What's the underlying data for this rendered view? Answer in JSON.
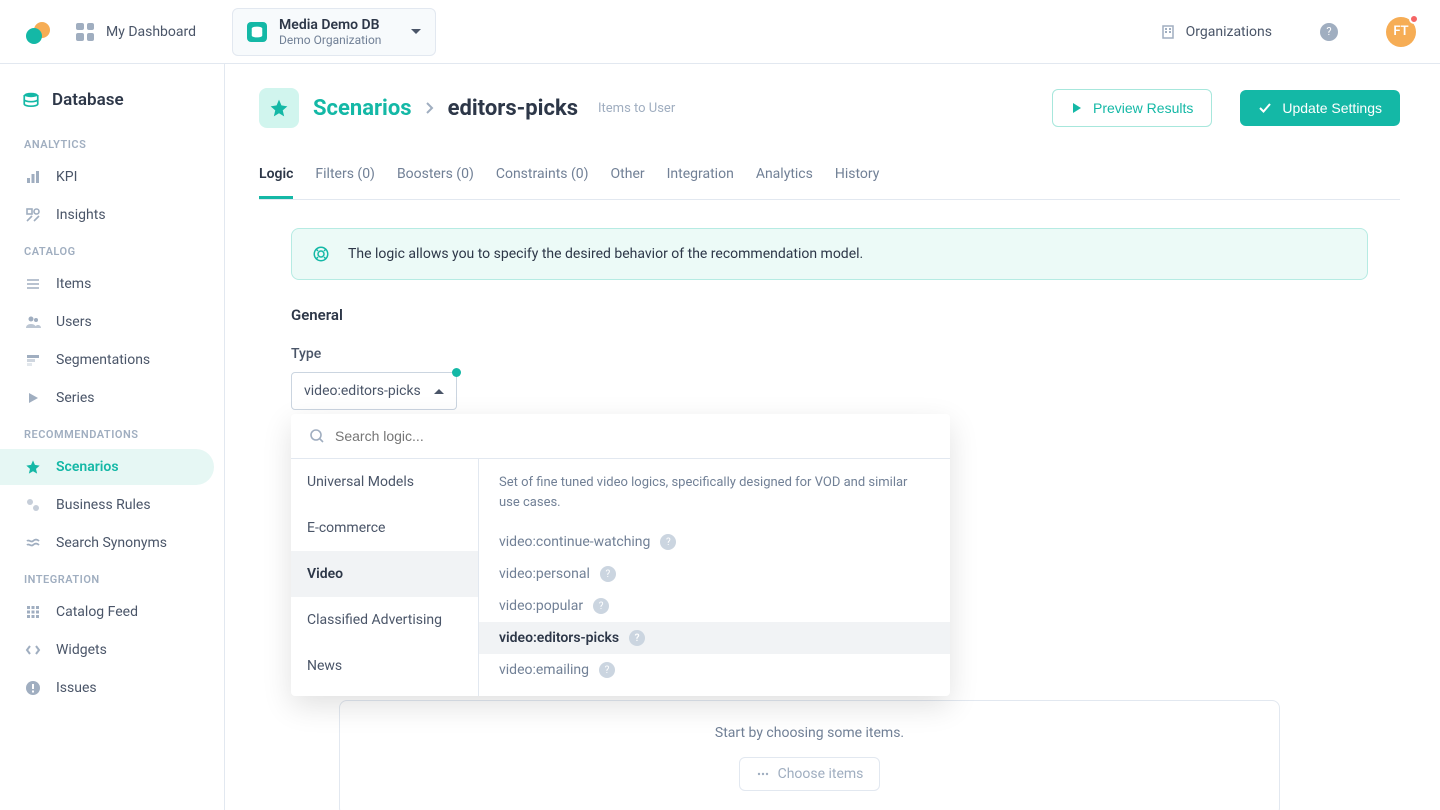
{
  "header": {
    "dashboard_label": "My Dashboard",
    "db": {
      "name": "Media Demo DB",
      "org": "Demo Organization"
    },
    "organizations_label": "Organizations",
    "avatar_initials": "FT"
  },
  "sidebar": {
    "title": "Database",
    "sections": [
      {
        "label": "ANALYTICS",
        "items": [
          {
            "key": "kpi",
            "label": "KPI",
            "icon": "bars"
          },
          {
            "key": "insights",
            "label": "Insights",
            "icon": "insights"
          }
        ]
      },
      {
        "label": "CATALOG",
        "items": [
          {
            "key": "items",
            "label": "Items",
            "icon": "list"
          },
          {
            "key": "users",
            "label": "Users",
            "icon": "users"
          },
          {
            "key": "segmentations",
            "label": "Segmentations",
            "icon": "seg"
          },
          {
            "key": "series",
            "label": "Series",
            "icon": "play"
          }
        ]
      },
      {
        "label": "RECOMMENDATIONS",
        "items": [
          {
            "key": "scenarios",
            "label": "Scenarios",
            "icon": "star",
            "active": true
          },
          {
            "key": "business-rules",
            "label": "Business Rules",
            "icon": "rules"
          },
          {
            "key": "search-synonyms",
            "label": "Search Synonyms",
            "icon": "approx"
          }
        ]
      },
      {
        "label": "INTEGRATION",
        "items": [
          {
            "key": "catalog-feed",
            "label": "Catalog Feed",
            "icon": "grid"
          },
          {
            "key": "widgets",
            "label": "Widgets",
            "icon": "code"
          },
          {
            "key": "issues",
            "label": "Issues",
            "icon": "warn"
          }
        ]
      }
    ]
  },
  "page": {
    "crumb1": "Scenarios",
    "crumb2": "editors-picks",
    "sub": "Items to User",
    "btn_preview": "Preview Results",
    "btn_update": "Update Settings",
    "tabs": [
      {
        "key": "logic",
        "label": "Logic",
        "active": true
      },
      {
        "key": "filters",
        "label": "Filters (0)"
      },
      {
        "key": "boosters",
        "label": "Boosters (0)"
      },
      {
        "key": "constraints",
        "label": "Constraints (0)"
      },
      {
        "key": "other",
        "label": "Other"
      },
      {
        "key": "integration",
        "label": "Integration"
      },
      {
        "key": "analytics",
        "label": "Analytics"
      },
      {
        "key": "history",
        "label": "History"
      }
    ],
    "note_text": "The logic allows you to specify the desired behavior of the recommendation model.",
    "general_title": "General",
    "type_label": "Type",
    "type_value": "video:editors-picks",
    "dropdown": {
      "search_placeholder": "Search logic...",
      "categories": [
        {
          "key": "universal",
          "label": "Universal Models"
        },
        {
          "key": "ecommerce",
          "label": "E-commerce"
        },
        {
          "key": "video",
          "label": "Video",
          "selected": true
        },
        {
          "key": "classified",
          "label": "Classified Advertising"
        },
        {
          "key": "news",
          "label": "News"
        }
      ],
      "description": "Set of fine tuned video logics, specifically designed for VOD and similar use cases.",
      "options": [
        {
          "key": "cw",
          "label": "video:continue-watching"
        },
        {
          "key": "personal",
          "label": "video:personal"
        },
        {
          "key": "popular",
          "label": "video:popular"
        },
        {
          "key": "editors",
          "label": "video:editors-picks",
          "selected": true
        },
        {
          "key": "emailing",
          "label": "video:emailing"
        }
      ]
    },
    "placeholder_text": "Start by choosing some items.",
    "choose_label": "Choose items"
  }
}
